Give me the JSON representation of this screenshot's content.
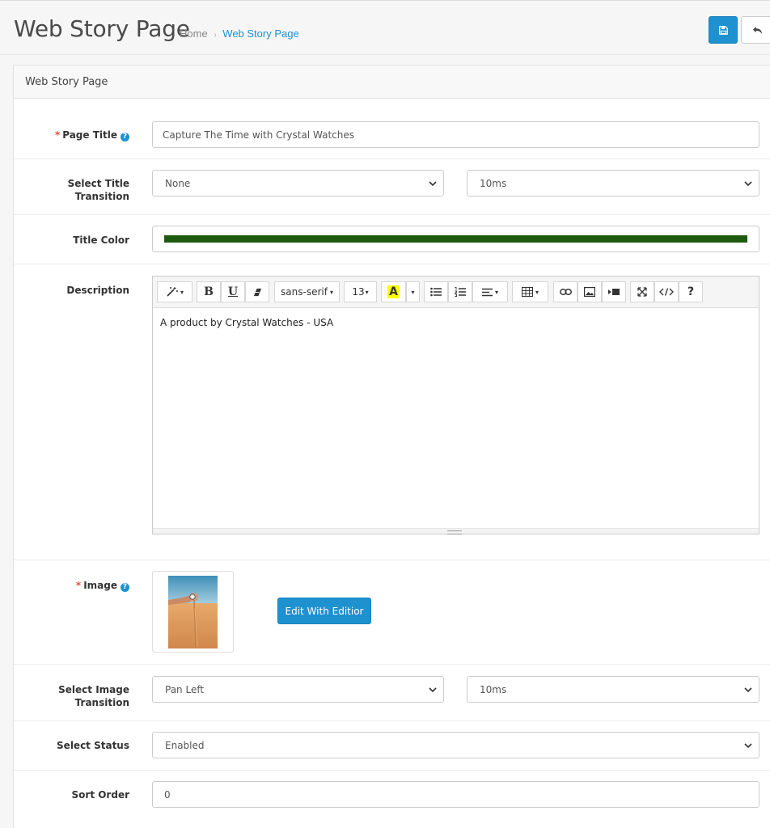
{
  "header": {
    "title": "Web Story Page",
    "breadcrumb": [
      {
        "label": "Home"
      },
      {
        "label": "Web Story Page"
      }
    ],
    "breadcrumb_separator": "›"
  },
  "panel": {
    "heading": "Web Story Page"
  },
  "form": {
    "page_title": {
      "label": "Page Title",
      "value": "Capture The Time with Crystal Watches"
    },
    "title_transition": {
      "label_line1": "Select Title",
      "label_line2": "Transition",
      "effect": "None",
      "duration": "10ms"
    },
    "title_color": {
      "label": "Title Color",
      "value": "#1e5a0f"
    },
    "description": {
      "label": "Description",
      "content": "A product by Crystal Watches - USA",
      "toolbar": {
        "bold": "B",
        "underline": "U",
        "font_family": "sans-serif",
        "font_size": "13",
        "color_letter": "A",
        "help": "?"
      }
    },
    "image": {
      "label": "Image",
      "edit_button": "Edit With Editior"
    },
    "image_transition": {
      "label_line1": "Select Image",
      "label_line2": "Transition",
      "effect": "Pan Left",
      "duration": "10ms"
    },
    "status": {
      "label": "Select Status",
      "value": "Enabled"
    },
    "sort_order": {
      "label": "Sort Order",
      "value": "0"
    }
  },
  "colors": {
    "accent": "#1e91cf",
    "required": "#e3503e",
    "title_color_swatch": "#1e5a0f"
  }
}
